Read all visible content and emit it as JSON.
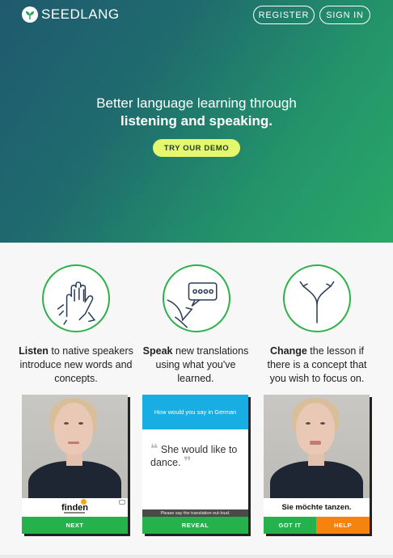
{
  "header": {
    "logo_text": "SEEDLANG",
    "register_label": "REGISTER",
    "signin_label": "SIGN IN"
  },
  "hero": {
    "line1": "Better language learning through",
    "line2": "listening and speaking.",
    "demo_label": "TRY OUR DEMO"
  },
  "features": [
    {
      "icon": "hand-icon",
      "title": "Listen",
      "text": " to native speakers introduce new words and concepts."
    },
    {
      "icon": "speech-bubble-icon",
      "title": "Speak",
      "text": " new translations using what you've learned."
    },
    {
      "icon": "fork-arrows-icon",
      "title": "Change",
      "text": " the lesson if there is a concept that you wish to focus on."
    }
  ],
  "cards": {
    "listen": {
      "word": "finden",
      "button": "NEXT"
    },
    "speak": {
      "prompt": "How would you say in German",
      "sentence": "She would like to dance.",
      "instruction": "Please say the translation out-loud.",
      "button": "REVEAL"
    },
    "change": {
      "sentence": "Sie möchte tanzen.",
      "got_it": "GOT IT",
      "help": "HELP"
    }
  },
  "colors": {
    "accent_green": "#25b14b",
    "help_orange": "#f7830f",
    "prompt_blue": "#19aee3",
    "demo_yellow": "#e4f76d"
  }
}
